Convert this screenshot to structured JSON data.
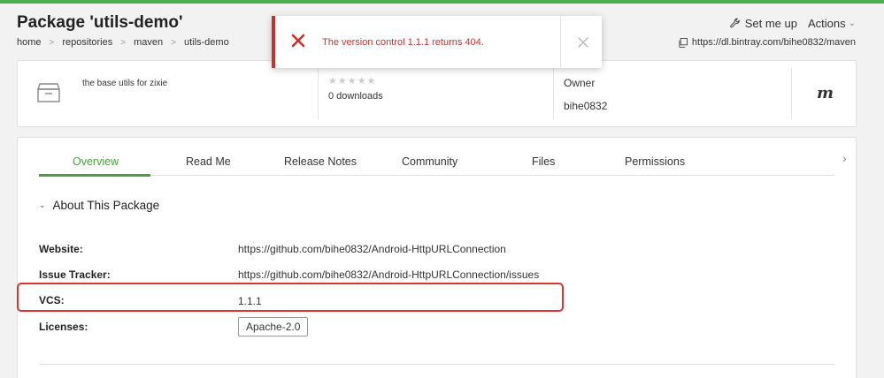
{
  "header": {
    "title": "Package 'utils-demo'",
    "set_me_up": "Set me up",
    "actions": "Actions",
    "download_url": "https://dl.bintray.com/bihe0832/maven"
  },
  "breadcrumb": [
    "home",
    "repositories",
    "maven",
    "utils-demo"
  ],
  "info": {
    "description": "the base utils for zixie",
    "stars": "★★★★★",
    "rating": 0,
    "downloads": "0 downloads",
    "owner_label": "Owner",
    "owner_name": "bihe0832",
    "repo_mark": "m"
  },
  "tabs": [
    {
      "label": "Overview",
      "active": true
    },
    {
      "label": "Read Me",
      "active": false
    },
    {
      "label": "Release Notes",
      "active": false
    },
    {
      "label": "Community",
      "active": false
    },
    {
      "label": "Files",
      "active": false
    },
    {
      "label": "Permissions",
      "active": false
    }
  ],
  "about": {
    "heading": "About This Package",
    "website_label": "Website:",
    "website_value": "https://github.com/bihe0832/Android-HttpURLConnection",
    "issue_label": "Issue Tracker:",
    "issue_value": "https://github.com/bihe0832/Android-HttpURLConnection/issues",
    "vcs_label": "VCS:",
    "vcs_value": "1.1.1",
    "licenses_label": "Licenses:",
    "license_value": "Apache-2.0"
  },
  "toast": {
    "message": "The version control 1.1.1 returns 404."
  },
  "colors": {
    "accent": "#4a9e3f",
    "error": "#c9302c",
    "highlight": "#e03131"
  }
}
